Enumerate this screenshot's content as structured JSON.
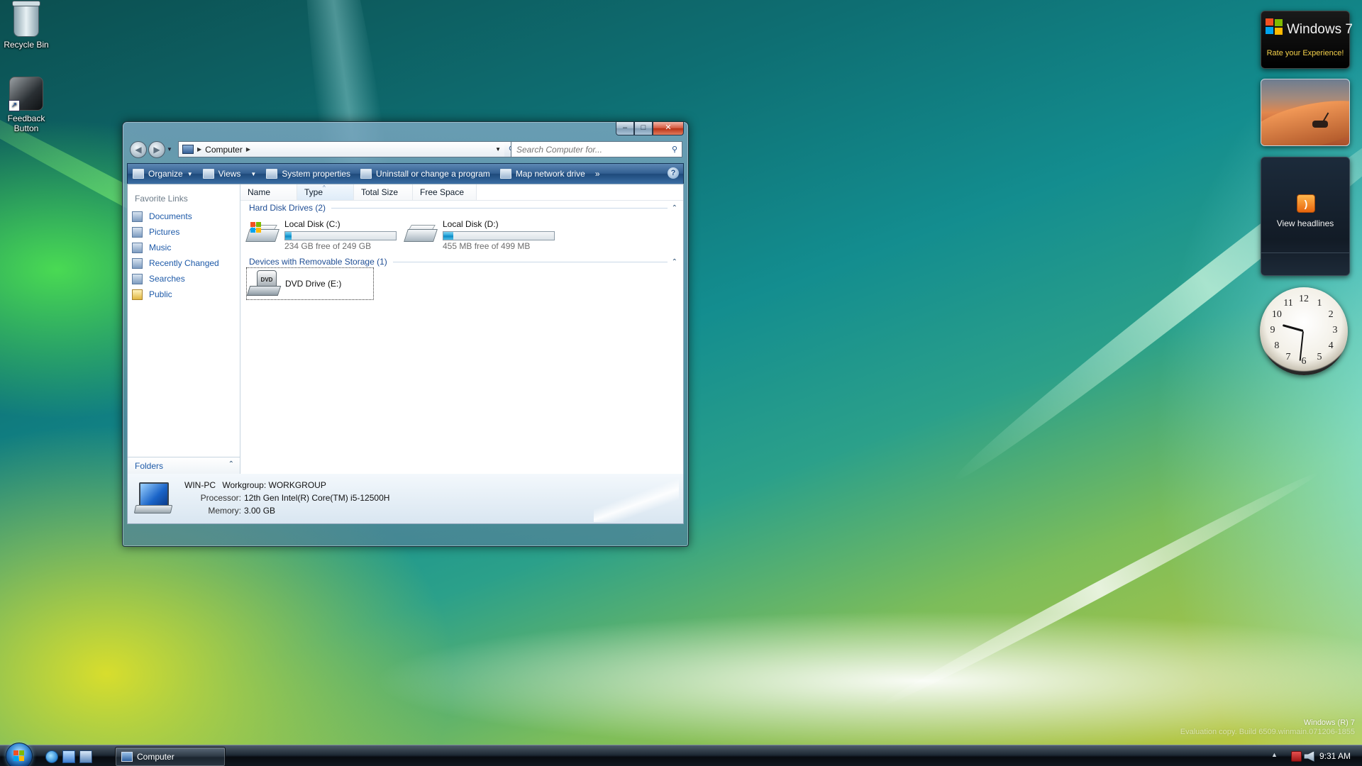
{
  "desktop": {
    "icons": [
      {
        "label": "Recycle Bin",
        "icon": "recycle-bin-icon"
      },
      {
        "label": "Feedback\nButton",
        "icon": "feedback-shortcut-icon"
      }
    ],
    "watermark": {
      "line1": "Windows (R) 7",
      "line2": "Evaluation copy. Build 6509.winmain.071206-1855"
    }
  },
  "explorer": {
    "window_controls": {
      "minimize": "–",
      "maximize": "□",
      "close": "✕"
    },
    "address": {
      "crumb": "Computer"
    },
    "search": {
      "placeholder": "Search Computer for..."
    },
    "toolbar": {
      "organize": "Organize",
      "views": "Views",
      "system_properties": "System properties",
      "uninstall": "Uninstall or change a program",
      "map_drive": "Map network drive",
      "more": "»",
      "help": "?"
    },
    "nav_pane": {
      "title": "Favorite Links",
      "items": [
        "Documents",
        "Pictures",
        "Music",
        "Recently Changed",
        "Searches",
        "Public"
      ],
      "folders_label": "Folders"
    },
    "columns": [
      "Name",
      "Type",
      "Total Size",
      "Free Space"
    ],
    "sorted_column": "Type",
    "groups": {
      "hard_disks": {
        "title": "Hard Disk Drives (2)"
      },
      "removable": {
        "title": "Devices with Removable Storage (1)"
      }
    },
    "drives": [
      {
        "name": "Local Disk (C:)",
        "free_text": "234 GB free of 249 GB",
        "used_fraction": 0.06,
        "system_drive": true
      },
      {
        "name": "Local Disk (D:)",
        "free_text": "455 MB free of 499 MB",
        "used_fraction": 0.09,
        "system_drive": false
      }
    ],
    "dvd": {
      "name": "DVD Drive (E:)",
      "badge": "DVD"
    },
    "details": {
      "computer_name": "WIN-PC",
      "workgroup_label": "Workgroup:",
      "workgroup": "WORKGROUP",
      "processor_label": "Processor:",
      "processor": "12th Gen Intel(R) Core(TM) i5-12500H",
      "memory_label": "Memory:",
      "memory": "3.00 GB"
    }
  },
  "gadgets": {
    "win7": {
      "title": "Windows 7",
      "subtitle": "Rate your Experience!"
    },
    "feed": {
      "label": "View headlines",
      "icon": "rss-icon"
    },
    "clock": {
      "numbers": [
        "12",
        "1",
        "2",
        "3",
        "4",
        "5",
        "6",
        "7",
        "8",
        "9",
        "10",
        "11"
      ],
      "hour": 9,
      "minute": 31
    }
  },
  "taskbar": {
    "task_button": "Computer",
    "time": "9:31 AM",
    "show_hidden": "▲"
  },
  "colors": {
    "link": "#1e5aa8",
    "toolbar": "#325f91",
    "progress": "#1ea0d8",
    "win_red": "#f25022",
    "win_green": "#7fba00",
    "win_blue": "#00a4ef",
    "win_yellow": "#ffb900"
  }
}
